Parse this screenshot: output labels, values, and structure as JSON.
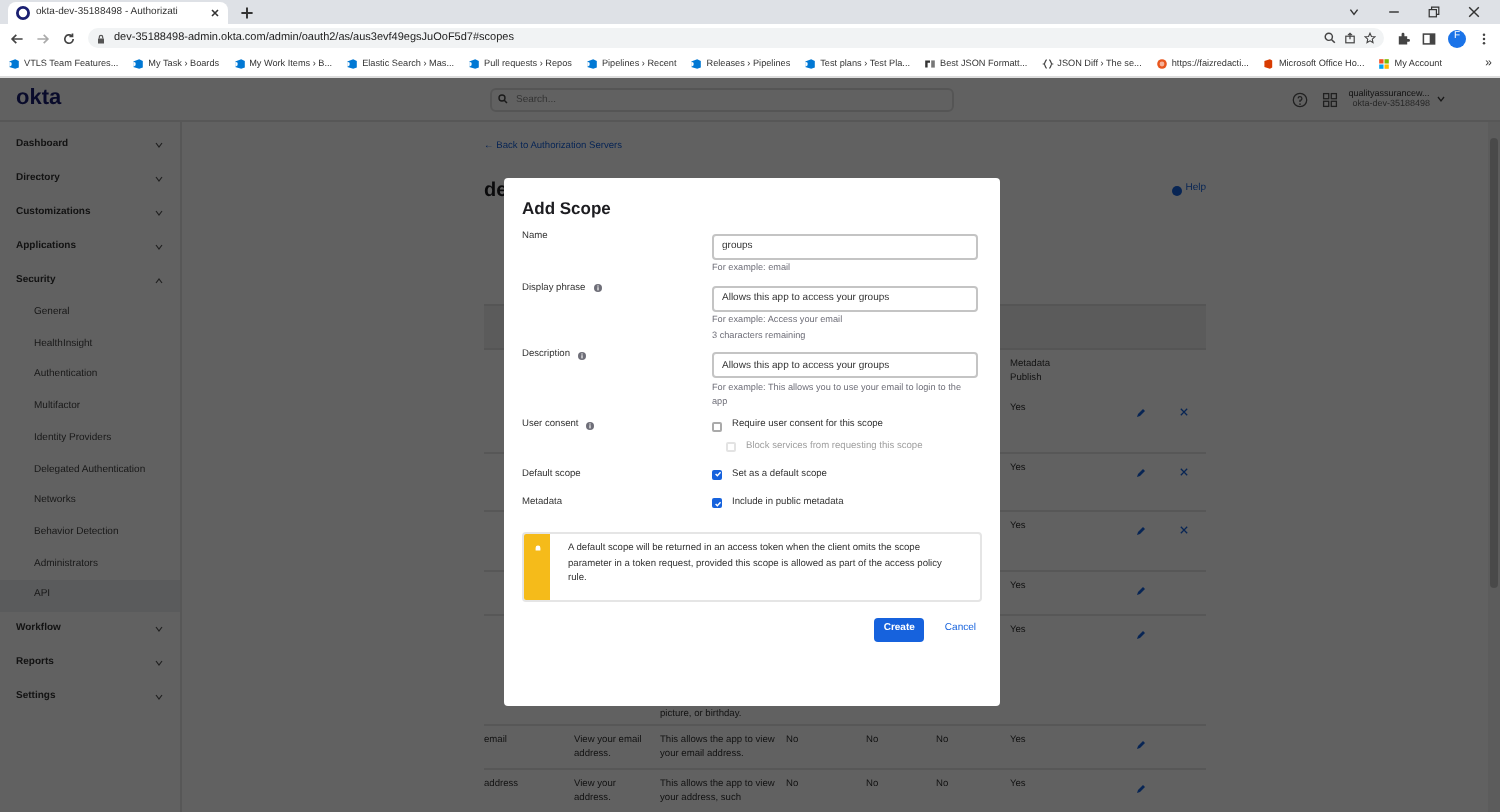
{
  "browser": {
    "tabs": [
      {
        "title": "okta-dev-35188498 - Authorizati",
        "selected": true
      }
    ],
    "url": "dev-35188498-admin.okta.com/admin/oauth2/as/aus3evf49egsJuOoF5d7#scopes",
    "profile_initial": "F",
    "bookmarks": [
      {
        "label": "VTLS Team Features...",
        "kind": "devops"
      },
      {
        "label": "My Task › Boards",
        "kind": "devops"
      },
      {
        "label": "My Work Items › B...",
        "kind": "devops"
      },
      {
        "label": "Elastic Search › Mas...",
        "kind": "devops"
      },
      {
        "label": "Pull requests › Repos",
        "kind": "devops"
      },
      {
        "label": "Pipelines › Recent",
        "kind": "devops"
      },
      {
        "label": "Releases › Pipelines",
        "kind": "devops"
      },
      {
        "label": "Test plans › Test Pla...",
        "kind": "devops"
      },
      {
        "label": "Best JSON Formatt...",
        "kind": "json"
      },
      {
        "label": "JSON Diff › The se...",
        "kind": "braces"
      },
      {
        "label": "https://faizredacti...",
        "kind": "web"
      },
      {
        "label": "Microsoft Office Ho...",
        "kind": "office"
      },
      {
        "label": "My Account",
        "kind": "grid"
      }
    ],
    "bookmarks_more": "»"
  },
  "header": {
    "logo": "okta",
    "search_placeholder": "Search...",
    "user_name": "qualityassurancew...",
    "user_org": "okta-dev-35188498"
  },
  "sidebar": {
    "items": [
      {
        "label": "Dashboard",
        "expanded": false
      },
      {
        "label": "Directory",
        "expanded": false
      },
      {
        "label": "Customizations",
        "expanded": false
      },
      {
        "label": "Applications",
        "expanded": false
      },
      {
        "label": "Security",
        "expanded": true,
        "children": [
          {
            "label": "General",
            "selected": false
          },
          {
            "label": "HealthInsight",
            "selected": false
          },
          {
            "label": "Authentication",
            "selected": false
          },
          {
            "label": "Multifactor",
            "selected": false
          },
          {
            "label": "Identity Providers",
            "selected": false
          },
          {
            "label": "Delegated Authentication",
            "selected": false
          },
          {
            "label": "Networks",
            "selected": false
          },
          {
            "label": "Behavior Detection",
            "selected": false
          },
          {
            "label": "Administrators",
            "selected": false
          },
          {
            "label": "API",
            "selected": true
          }
        ]
      },
      {
        "label": "Workflow",
        "expanded": false
      },
      {
        "label": "Reports",
        "expanded": false
      },
      {
        "label": "Settings",
        "expanded": false
      }
    ]
  },
  "page": {
    "back_link": "← Back to Authorization Servers",
    "title": "de",
    "help": "Help",
    "table": {
      "metadata_header": "Metadata Publish",
      "rows": [
        {
          "metadata": "Yes",
          "editable": true,
          "deletable": true
        },
        {
          "metadata": "Yes",
          "editable": true,
          "deletable": true
        },
        {
          "metadata": "Yes",
          "editable": true,
          "deletable": true
        },
        {
          "metadata": "Yes",
          "editable": true,
          "deletable": false
        },
        {
          "description": "picture, or birthday.",
          "metadata": "Yes",
          "editable": true,
          "deletable": false
        },
        {
          "name": "email",
          "display": "View your email address.",
          "description": "This allows the app to view your email address.",
          "consent": "No",
          "default": "No",
          "system": "No",
          "metadata": "Yes",
          "editable": true,
          "deletable": false
        },
        {
          "name": "address",
          "display": "View your address.",
          "description": "This allows the app to view your address, such",
          "consent": "No",
          "default": "No",
          "system": "No",
          "metadata": "Yes",
          "editable": true,
          "deletable": false
        }
      ]
    }
  },
  "modal": {
    "title": "Add Scope",
    "fields": [
      {
        "kind": "text",
        "label": "Name",
        "info": false,
        "value": "groups",
        "hints": [
          "For example: email"
        ]
      },
      {
        "kind": "text",
        "label": "Display phrase",
        "info": true,
        "value": "Allows this app to access your groups",
        "hints": [
          "For example: Access your email",
          "3 characters remaining"
        ]
      },
      {
        "kind": "text",
        "label": "Description",
        "info": true,
        "value": "Allows this app to access your groups",
        "hints": [
          "For example: This allows you to use your email to login to the app"
        ]
      },
      {
        "kind": "checkbox",
        "label": "User consent",
        "info": true,
        "options": [
          {
            "label": "Require user consent for this scope",
            "checked": false,
            "disabled": false,
            "children": [
              {
                "label": "Block services from requesting this scope",
                "checked": false,
                "disabled": true
              }
            ]
          }
        ]
      },
      {
        "kind": "checkbox",
        "label": "Default scope",
        "info": false,
        "options": [
          {
            "label": "Set as a default scope",
            "checked": true,
            "disabled": false
          }
        ]
      },
      {
        "kind": "checkbox",
        "label": "Metadata",
        "info": false,
        "options": [
          {
            "label": "Include in public metadata",
            "checked": true,
            "disabled": false
          }
        ]
      }
    ],
    "alert": "A default scope will be returned in an access token when the client omits the scope parameter in a token request, provided this scope is allowed as part of the access policy rule.",
    "buttons": [
      {
        "label": "Create",
        "kind": "primary"
      },
      {
        "label": "Cancel",
        "kind": "link"
      }
    ]
  }
}
